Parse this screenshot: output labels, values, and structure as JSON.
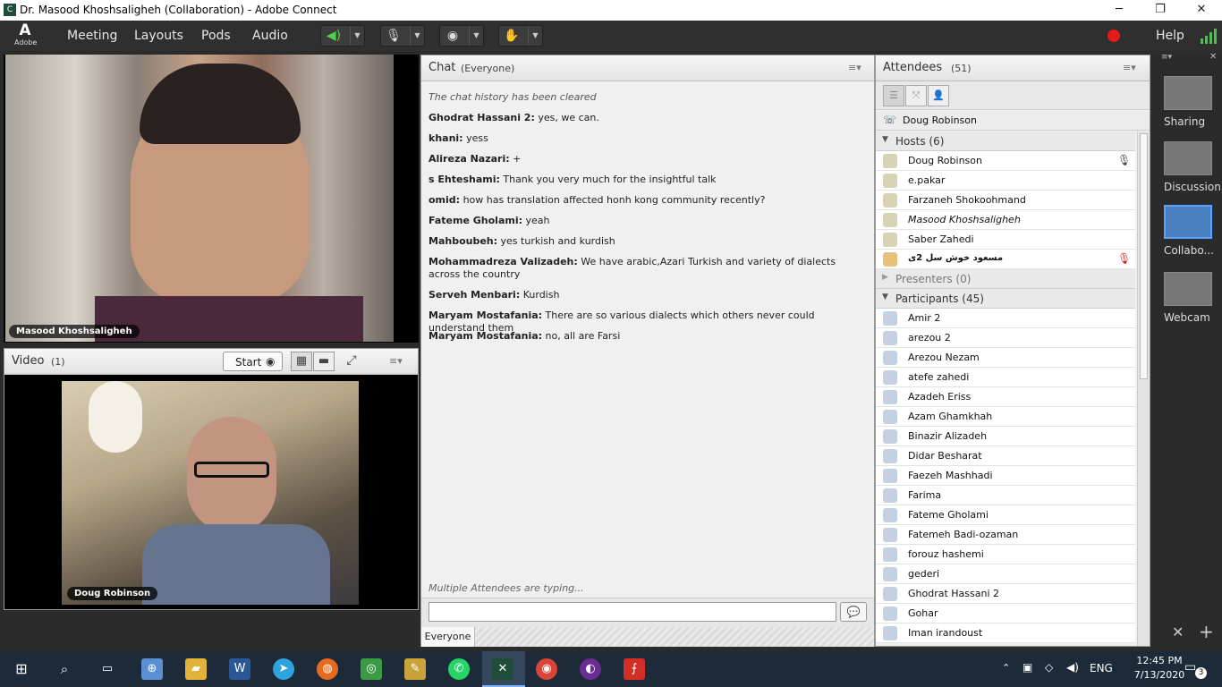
{
  "window": {
    "title": "Dr. Masood Khoshsaligheh (Collaboration) - Adobe Connect",
    "minimize": "─",
    "maximize": "❐",
    "close": "✕"
  },
  "menubar": {
    "logo": "Adobe",
    "menus": [
      "Meeting",
      "Layouts",
      "Pods",
      "Audio"
    ],
    "help": "Help",
    "recording_color": "#e31b1b"
  },
  "cam_pod": {
    "name_label": "Masood Khoshsaligheh"
  },
  "video_pod": {
    "title": "Video",
    "count": "(1)",
    "start_label": "Start",
    "name_label": "Doug Robinson"
  },
  "chat_pod": {
    "title": "Chat",
    "scope": "(Everyone)",
    "cleared_notice": "The chat history has been cleared",
    "messages": [
      {
        "sender": "Ghodrat Hassani 2:",
        "text": "yes, we can."
      },
      {
        "sender": "khani:",
        "text": "yess"
      },
      {
        "sender": "Alireza Nazari:",
        "text": "+"
      },
      {
        "sender": "s Ehteshami:",
        "text": "Thank you very much for the insightful talk"
      },
      {
        "sender": "omid:",
        "text": "how has translation affected honh kong community recently?"
      },
      {
        "sender": "Fateme Gholami:",
        "text": "yeah"
      },
      {
        "sender": "Mahboubeh:",
        "text": "yes turkish and kurdish"
      },
      {
        "sender": "Mohammadreza Valizadeh:",
        "text": "We have arabic,Azari Turkish and variety of dialects across the country"
      },
      {
        "sender": "Serveh Menbari:",
        "text": "Kurdish"
      },
      {
        "sender": "Maryam Mostafania:",
        "text": "There are so various dialects which others never could understand them"
      },
      {
        "sender": "Maryam Mostafania:",
        "text": "no, all are Farsi"
      }
    ],
    "typing_notice": "Multiple Attendees are typing...",
    "input_value": "",
    "recipient_tab": "Everyone"
  },
  "attendees_pod": {
    "title": "Attendees",
    "count": "(51)",
    "current_user": "Doug Robinson",
    "hosts_label": "Hosts (6)",
    "hosts": [
      "Doug Robinson",
      "e.pakar",
      "Farzaneh Shokoohmand",
      "Masood Khoshsaligheh",
      "Saber Zahedi",
      "مسعود خوش سل 2ی"
    ],
    "presenters_label": "Presenters (0)",
    "participants_label": "Participants (45)",
    "participants": [
      "Amir 2",
      "arezou 2",
      "Arezou Nezam",
      "atefe zahedi",
      "Azadeh Eriss",
      "Azam Ghamkhah",
      "Binazir Alizadeh",
      "Didar Besharat",
      "Faezeh Mashhadi",
      "Farima",
      "Fateme Gholami",
      "Fatemeh Badi-ozaman",
      "forouz hashemi",
      "gederi",
      "Ghodrat Hassani 2",
      "Gohar",
      "Iman irandoust"
    ]
  },
  "layouts": [
    "Sharing",
    "Discussion",
    "Collabo...",
    "Webcam"
  ],
  "taskbar": {
    "language": "ENG",
    "time": "12:45 PM",
    "date": "7/13/2020",
    "notifications": "3"
  }
}
